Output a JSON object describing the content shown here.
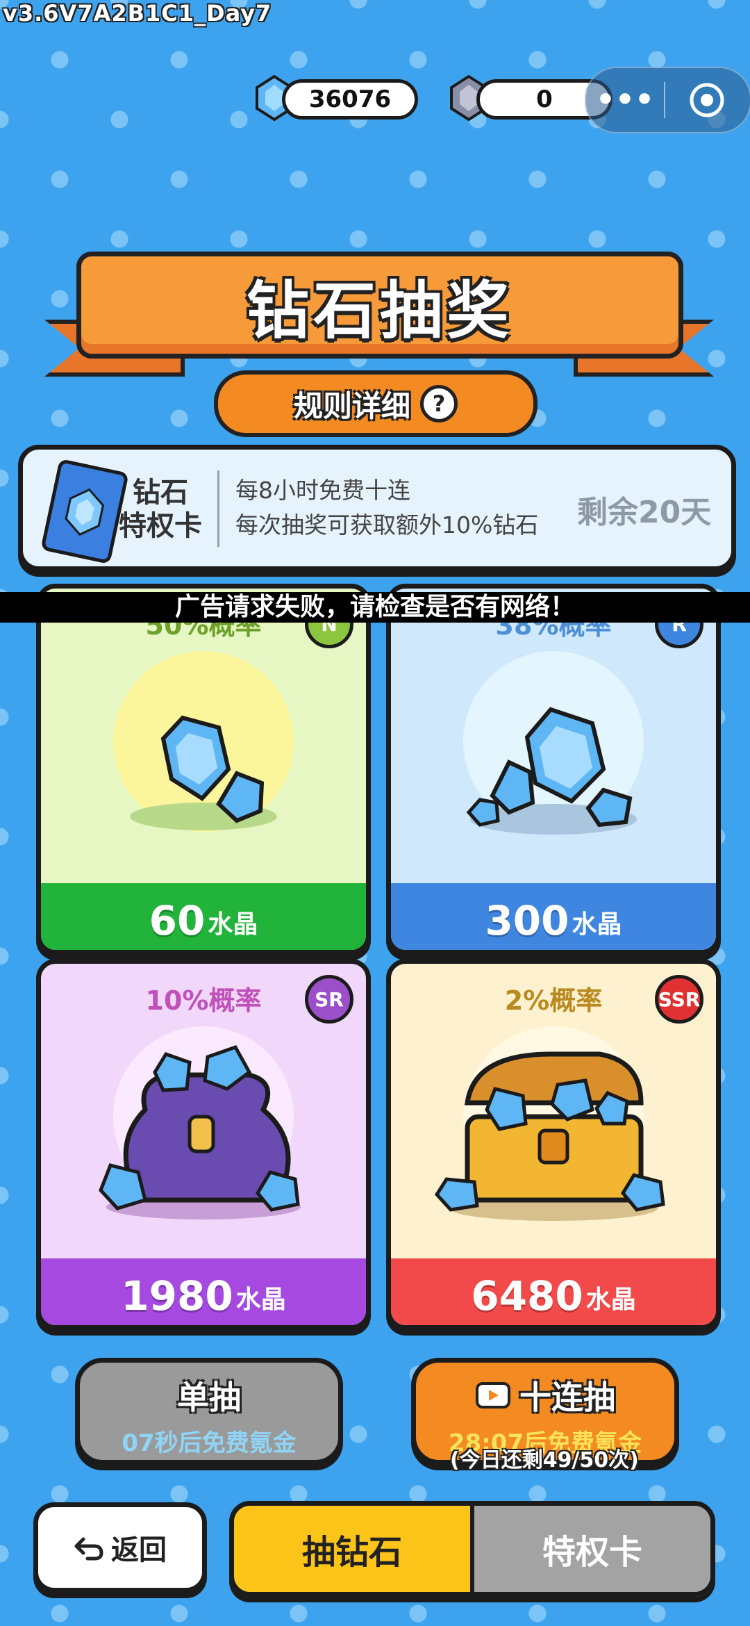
{
  "debug": {
    "version": "v3.6V7A2B1C1_Day7"
  },
  "currency": {
    "diamonds": "36076",
    "crystals": "0"
  },
  "system_capsule": {
    "more": "•••"
  },
  "header": {
    "title": "钻石抽奖",
    "rules_label": "规则详细",
    "help": "?"
  },
  "privilege_card": {
    "name_line1": "钻石",
    "name_line2": "特权卡",
    "desc_line1": "每8小时免费十连",
    "desc_line2": "每次抽奖可获取额外10%钻石",
    "remaining": "剩余20天"
  },
  "toast": {
    "message": "广告请求失败，请检查是否有网络！"
  },
  "prizes": [
    {
      "probability": "50%概率",
      "rarity": "N",
      "amount": "60",
      "unit": "水晶"
    },
    {
      "probability": "38%概率",
      "rarity": "R",
      "amount": "300",
      "unit": "水晶"
    },
    {
      "probability": "10%概率",
      "rarity": "SR",
      "amount": "1980",
      "unit": "水晶"
    },
    {
      "probability": "2%概率",
      "rarity": "SSR",
      "amount": "6480",
      "unit": "水晶"
    }
  ],
  "draw_single": {
    "label": "单抽",
    "sub": "07秒后免费氪金"
  },
  "draw_ten": {
    "label": "十连抽",
    "sub": "28:07后免费氪金",
    "note": "(今日还剩49/50次)"
  },
  "nav": {
    "back": "返回",
    "tab_diamond": "抽钻石",
    "tab_card": "特权卡"
  },
  "colors": {
    "background": "#3ea3ee",
    "orange": "#f48a22",
    "yellow": "#fcc419",
    "grey": "#a3a3a3"
  }
}
